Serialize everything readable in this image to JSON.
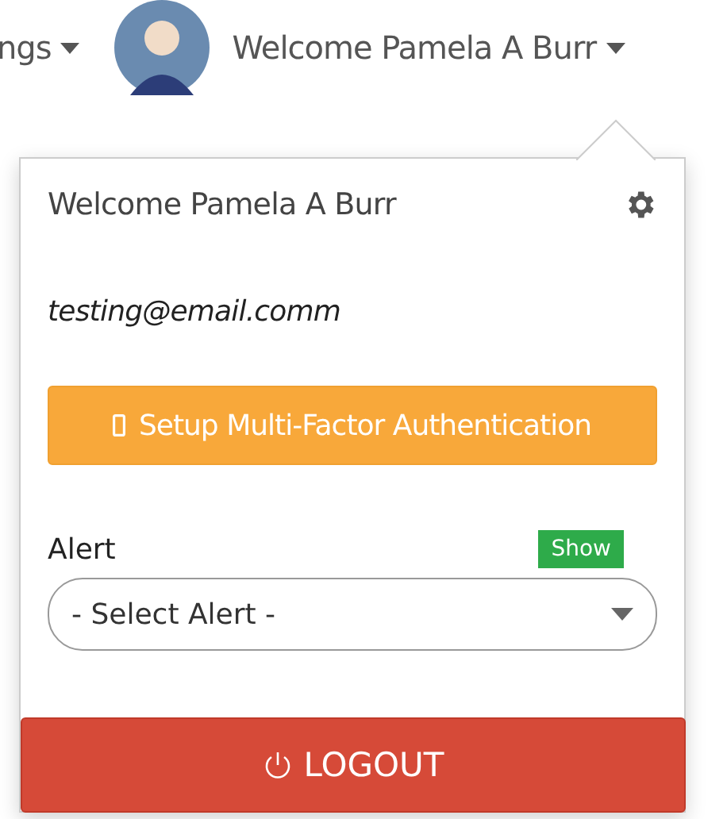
{
  "nav": {
    "menu_label": "ngs",
    "user_label": "Welcome Pamela A Burr"
  },
  "popover": {
    "title": "Welcome Pamela A Burr",
    "email": "testing@email.comm",
    "mfa_button": "Setup Multi-Factor Authentication",
    "alert": {
      "label": "Alert",
      "show_button": "Show",
      "select": {
        "value": "- Select Alert -"
      }
    },
    "logout_button": "LOGOUT"
  }
}
